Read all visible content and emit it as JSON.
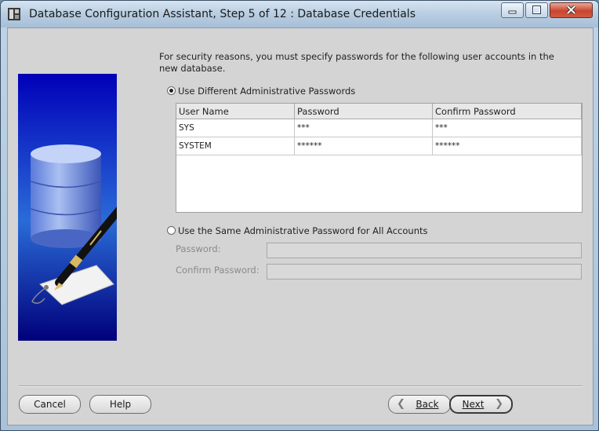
{
  "window": {
    "title": "Database Configuration Assistant, Step 5 of 12 : Database Credentials"
  },
  "intro_text": "For security reasons, you must specify passwords for the following user accounts in the new database.",
  "options": {
    "different_label": "Use Different Administrative Passwords",
    "different_selected": true,
    "same_label": "Use the Same Administrative Password for All Accounts",
    "same_selected": false
  },
  "table": {
    "headers": [
      "User Name",
      "Password",
      "Confirm Password"
    ],
    "rows": [
      [
        "SYS",
        "***",
        "***"
      ],
      [
        "SYSTEM",
        "******",
        "******"
      ]
    ]
  },
  "fields": {
    "password_label": "Password:",
    "confirm_label": "Confirm Password:"
  },
  "buttons": {
    "cancel": "Cancel",
    "help": "Help",
    "back": "Back",
    "next": "Next"
  }
}
